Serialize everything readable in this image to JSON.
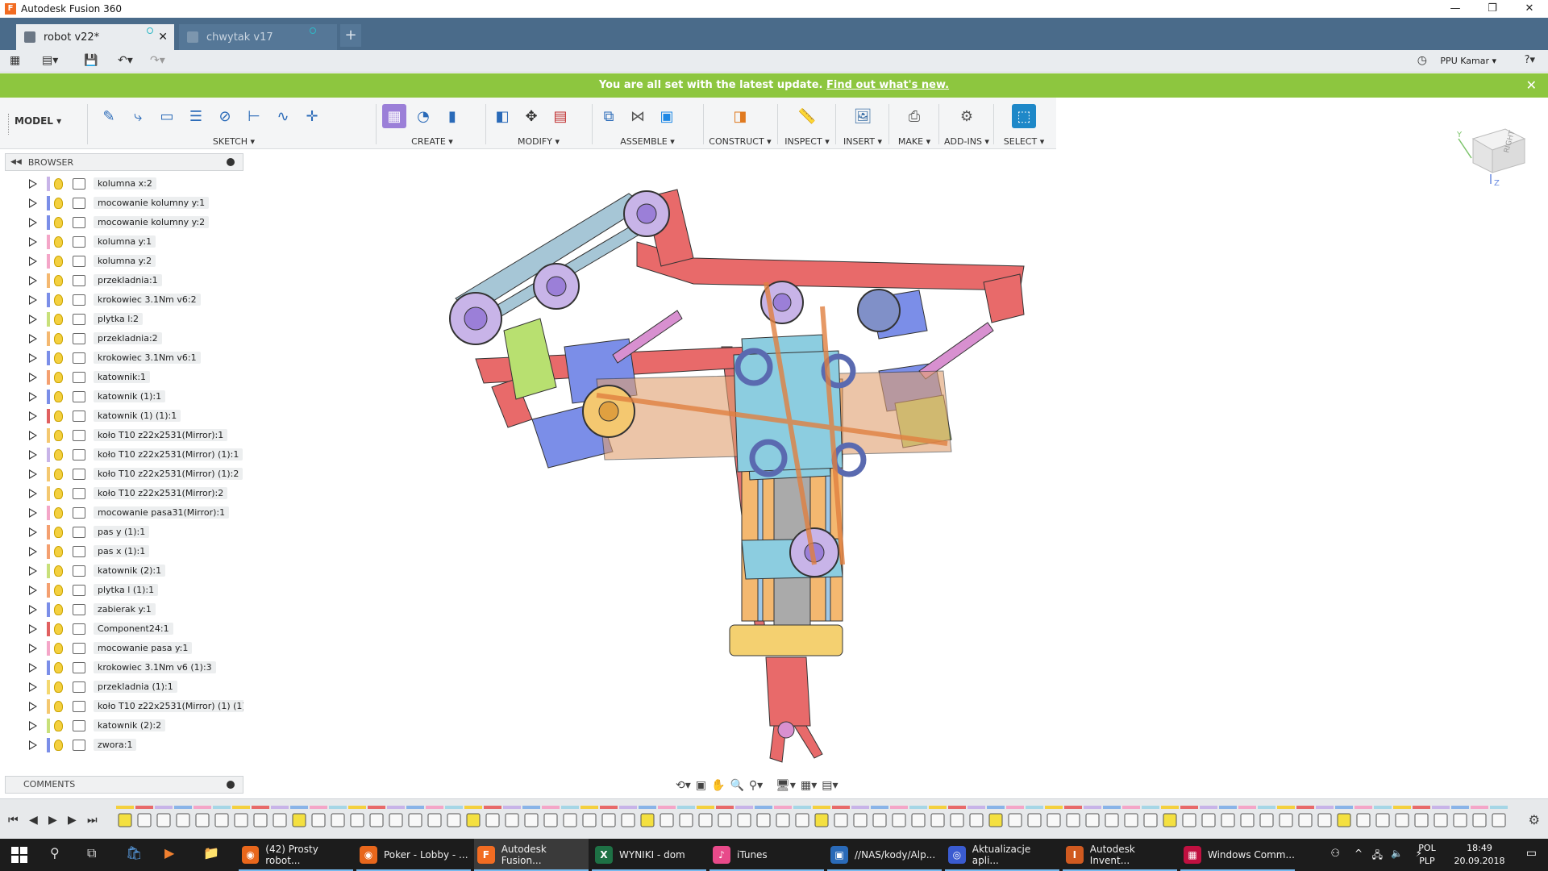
{
  "window": {
    "title": "Autodesk Fusion 360",
    "app_icon": "F",
    "minimize": "—",
    "restore": "❐",
    "close": "✕"
  },
  "tabs": [
    {
      "label": "robot v22*",
      "active": true
    },
    {
      "label": "chwytak v17",
      "active": false
    }
  ],
  "new_tab": "+",
  "qat": {
    "user": "PPU Kamar ▾",
    "help": "?▾"
  },
  "banner": {
    "text": "You are all set with the latest update.",
    "link": "Find out what's new."
  },
  "workspace": "MODEL ▾",
  "toolbar_groups": [
    {
      "label": "SKETCH ▾"
    },
    {
      "label": "CREATE ▾"
    },
    {
      "label": "MODIFY ▾"
    },
    {
      "label": "ASSEMBLE ▾"
    },
    {
      "label": "CONSTRUCT ▾"
    },
    {
      "label": "INSPECT ▾"
    },
    {
      "label": "INSERT ▾"
    },
    {
      "label": "MAKE ▾"
    },
    {
      "label": "ADD-INS ▾"
    },
    {
      "label": "SELECT ▾"
    }
  ],
  "viewcube": {
    "face": "RIGHT",
    "y_axis": "Y",
    "z_axis": "Z"
  },
  "browser": {
    "title": "BROWSER",
    "items": [
      {
        "label": "kolumna x:2",
        "color": "#c8b4e8"
      },
      {
        "label": "mocowanie kolumny y:1",
        "color": "#7b8ee8"
      },
      {
        "label": "mocowanie kolumny y:2",
        "color": "#7b8ee8"
      },
      {
        "label": "kolumna y:1",
        "color": "#f4a6c8"
      },
      {
        "label": "kolumna y:2",
        "color": "#f4a6c8"
      },
      {
        "label": "przekladnia:1",
        "color": "#f4b870"
      },
      {
        "label": "krokowiec 3.1Nm v6:2",
        "color": "#7b8ee8"
      },
      {
        "label": "plytka l:2",
        "color": "#c8e07a"
      },
      {
        "label": "przekladnia:2",
        "color": "#f4b870"
      },
      {
        "label": "krokowiec 3.1Nm v6:1",
        "color": "#7b8ee8"
      },
      {
        "label": "katownik:1",
        "color": "#f4a070"
      },
      {
        "label": "katownik (1):1",
        "color": "#7b8ee8"
      },
      {
        "label": "katownik (1) (1):1",
        "color": "#e06060"
      },
      {
        "label": "koło T10 z22x2531(Mirror):1",
        "color": "#f4c870"
      },
      {
        "label": "koło T10 z22x2531(Mirror) (1):1",
        "color": "#c8b4e8"
      },
      {
        "label": "koło T10 z22x2531(Mirror) (1):2",
        "color": "#f4c870"
      },
      {
        "label": "koło T10 z22x2531(Mirror):2",
        "color": "#f4c870"
      },
      {
        "label": "mocowanie pasa31(Mirror):1",
        "color": "#f4a6c8"
      },
      {
        "label": "pas y (1):1",
        "color": "#f4a070"
      },
      {
        "label": "pas x (1):1",
        "color": "#f4a070"
      },
      {
        "label": "katownik (2):1",
        "color": "#c8e07a"
      },
      {
        "label": "plytka l (1):1",
        "color": "#f4a070"
      },
      {
        "label": "zabierak y:1",
        "color": "#7b8ee8"
      },
      {
        "label": "Component24:1",
        "color": "#e06060"
      },
      {
        "label": "mocowanie pasa y:1",
        "color": "#f4a6c8"
      },
      {
        "label": "krokowiec 3.1Nm v6 (1):3",
        "color": "#7b8ee8"
      },
      {
        "label": "przekladnia (1):1",
        "color": "#f4d870"
      },
      {
        "label": "koło T10 z22x2531(Mirror) (1) (1):1",
        "color": "#f4c870"
      },
      {
        "label": "katownik (2):2",
        "color": "#c8e07a"
      },
      {
        "label": "zwora:1",
        "color": "#7b8ee8"
      }
    ]
  },
  "comments": {
    "title": "COMMENTS"
  },
  "taskbar": {
    "apps": [
      {
        "label": "(42) Prosty robot...",
        "icon_color": "#e8671c",
        "glyph": "◉",
        "open": true,
        "active": false
      },
      {
        "label": "Poker - Lobby - ...",
        "icon_color": "#e8671c",
        "glyph": "◉",
        "open": true,
        "active": false
      },
      {
        "label": "Autodesk Fusion...",
        "icon_color": "#f26c22",
        "glyph": "F",
        "open": true,
        "active": true
      },
      {
        "label": "WYNIKI - dom",
        "icon_color": "#1e7145",
        "glyph": "X",
        "open": true,
        "active": false
      },
      {
        "label": "iTunes",
        "icon_color": "#e84a8a",
        "glyph": "♪",
        "open": true,
        "active": false
      },
      {
        "label": "//NAS/kody/Alp...",
        "icon_color": "#2a6ab8",
        "glyph": "▣",
        "open": true,
        "active": false
      },
      {
        "label": "Aktualizacje apli...",
        "icon_color": "#3a5bd0",
        "glyph": "◎",
        "open": true,
        "active": false
      },
      {
        "label": "Autodesk Invent...",
        "icon_color": "#d05a20",
        "glyph": "I",
        "open": true,
        "active": false
      },
      {
        "label": "Windows Comm...",
        "icon_color": "#c01040",
        "glyph": "▦",
        "open": true,
        "active": false
      }
    ],
    "lang_top": "POL",
    "lang_bottom": "PLP",
    "time": "18:49",
    "date": "20.09.2018"
  }
}
